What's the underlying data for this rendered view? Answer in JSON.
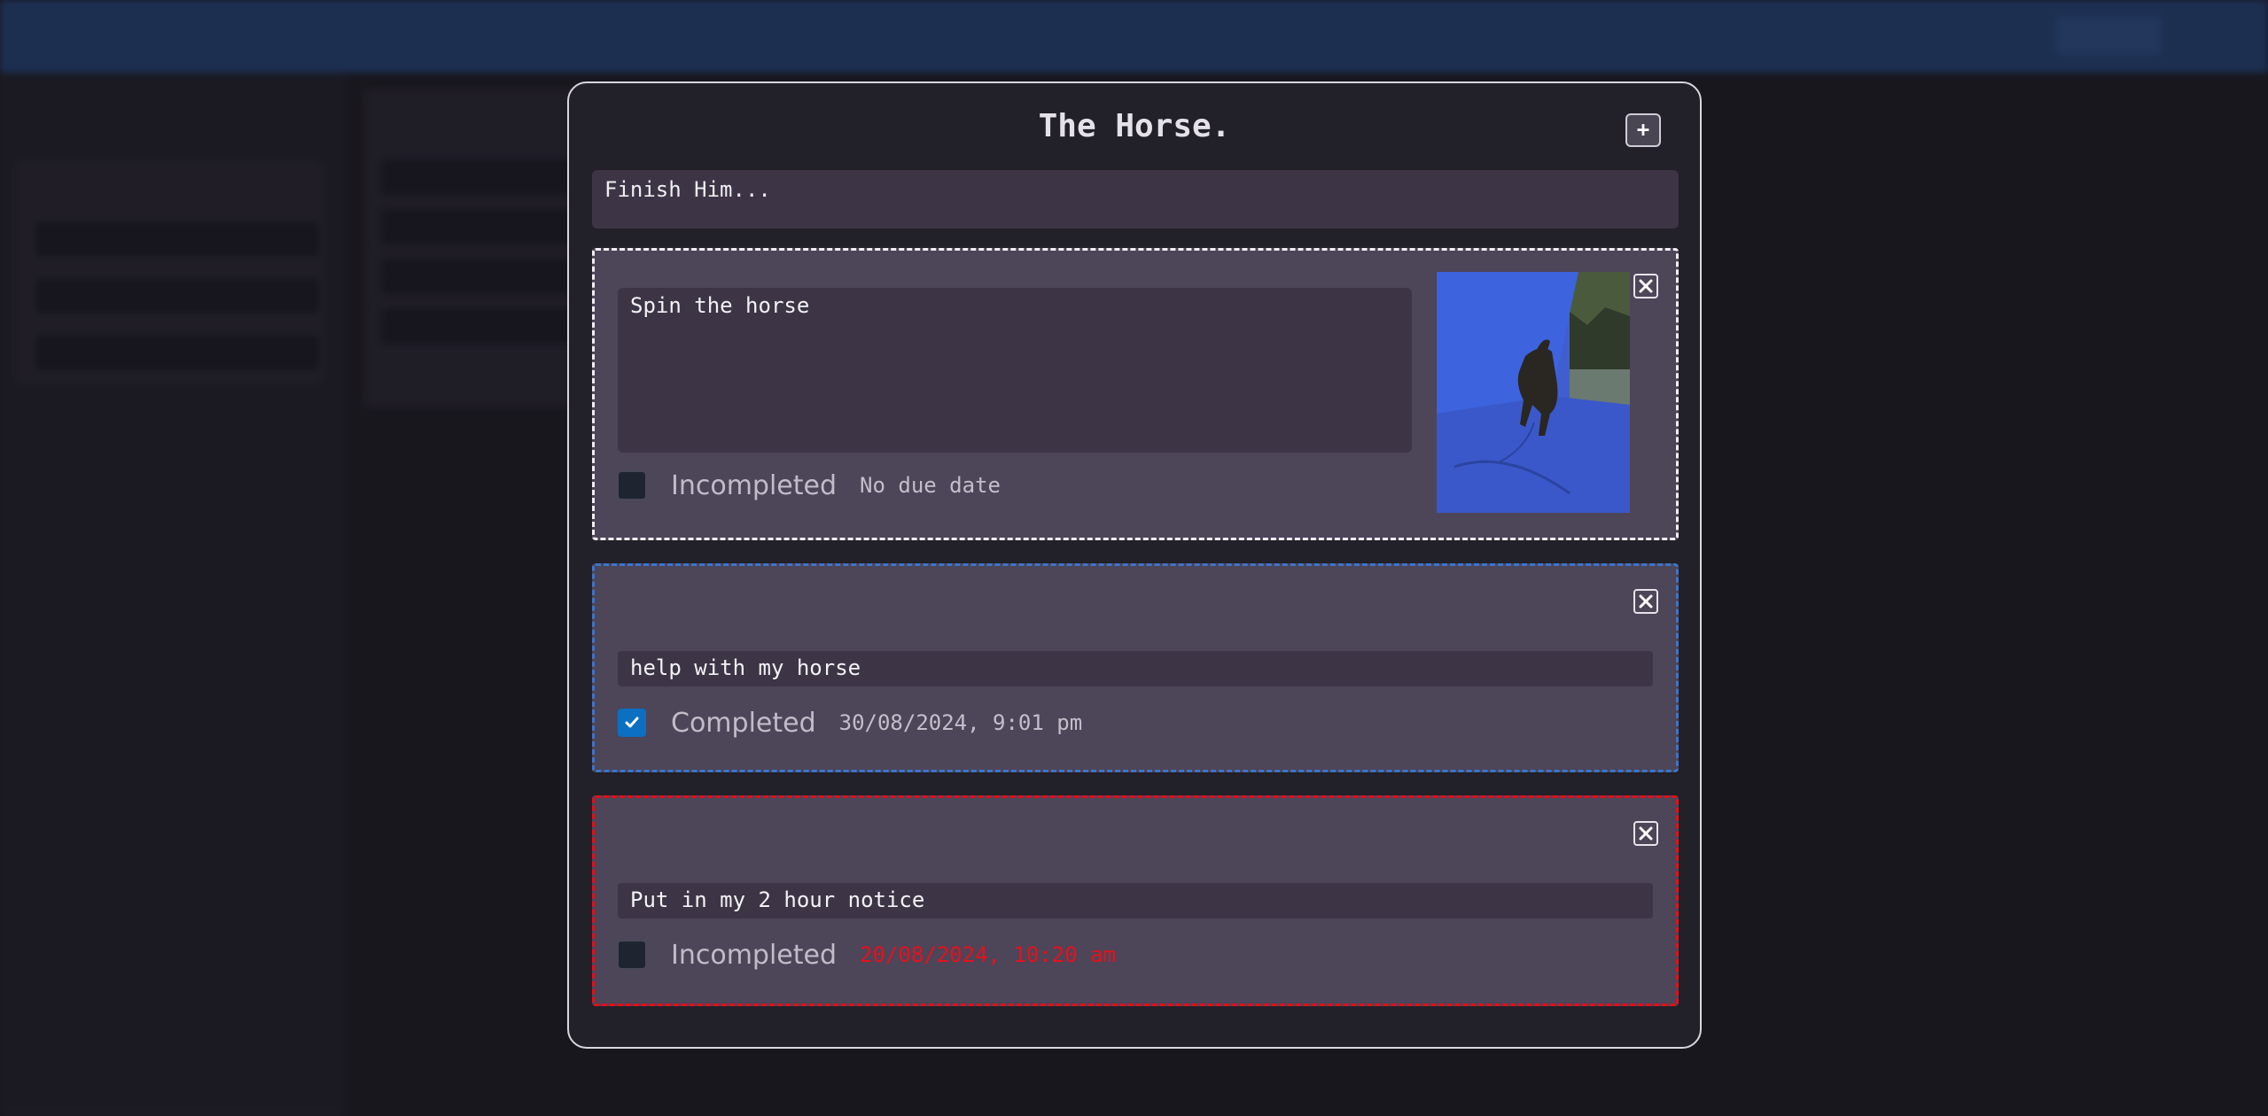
{
  "background_app": {
    "title": "",
    "sidebar_labels": []
  },
  "modal": {
    "title": "The Horse.",
    "add_button": "+",
    "description": "Finish Him..."
  },
  "tasks": [
    {
      "text": "Spin the horse",
      "status": "Incompleted",
      "completed": false,
      "due": "No due date",
      "overdue": false,
      "has_image": true,
      "image_subject": "horse running in front of blue tarp"
    },
    {
      "text": "help with my horse",
      "status": "Completed",
      "completed": true,
      "due": "30/08/2024, 9:01 pm",
      "overdue": false,
      "has_image": false
    },
    {
      "text": "Put in my 2 hour notice",
      "status": "Incompleted",
      "completed": false,
      "due": "20/08/2024, 10:20 am",
      "overdue": true,
      "has_image": false
    }
  ],
  "colors": {
    "accent_blue": "#3d74c8",
    "overdue_red": "#e0101c",
    "checkbox_checked": "#0d6fc2"
  }
}
